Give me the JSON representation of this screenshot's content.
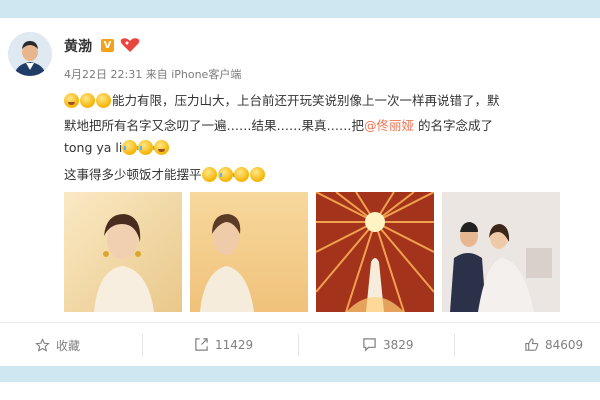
{
  "user": {
    "name": "黄渤",
    "verified_badge": "V"
  },
  "meta": {
    "timestamp": "4月22日 22:31",
    "source": "来自 iPhone客户端"
  },
  "post": {
    "line1_text": "能力有限，压力山大，上台前还开玩笑说别像上一次一样再说错了，默",
    "line2_prefix": "默地把所有名字又念叨了一遍……结果……果真……把",
    "mention": "@佟丽娅",
    "line2_suffix": " 的名字念成了",
    "line3_text": "tong ya li",
    "line4_text": "这事得多少顿饭才能摆平"
  },
  "photos": [
    {
      "icon": "woman-portrait-photo"
    },
    {
      "icon": "woman-profile-photo"
    },
    {
      "icon": "stage-performance-photo"
    },
    {
      "icon": "couple-photo"
    }
  ],
  "actions": {
    "favorite": "收藏",
    "repost_count": "11429",
    "comment_count": "3829",
    "like_count": "84609"
  },
  "colors": {
    "band": "#cfe7f1",
    "mention": "#eb7350",
    "badge": "#f4a21a"
  }
}
